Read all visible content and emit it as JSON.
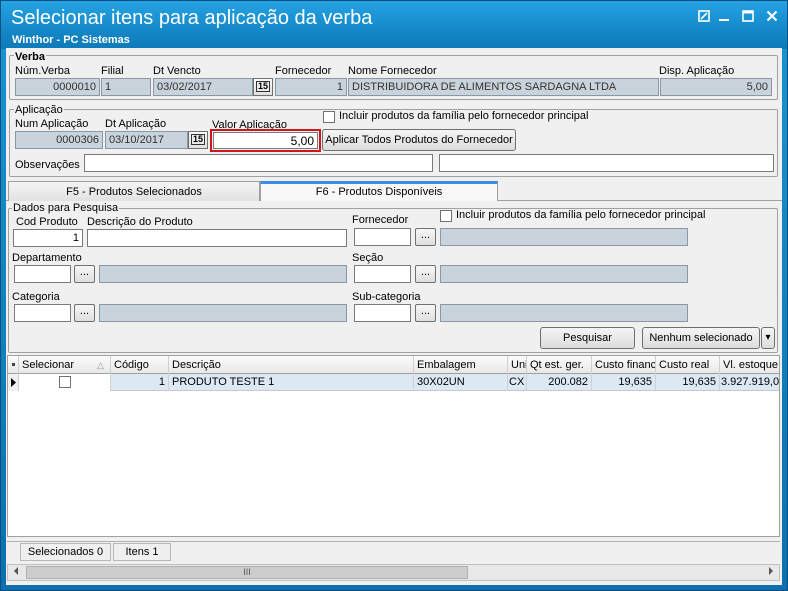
{
  "window": {
    "title": "Selecionar itens para aplicação da verba",
    "subtitle": "Winthor - PC Sistemas"
  },
  "verba": {
    "group_label": "Verba",
    "num_verba_label": "Núm.Verba",
    "num_verba": "0000010",
    "filial_label": "Filial",
    "filial": "1",
    "dt_vencto_label": "Dt Vencto",
    "dt_vencto": "03/02/2017",
    "fornecedor_label": "Fornecedor",
    "fornecedor": "1",
    "nome_fornecedor_label": "Nome Fornecedor",
    "nome_fornecedor": "DISTRIBUIDORA DE ALIMENTOS SARDAGNA LTDA",
    "disp_aplicacao_label": "Disp. Aplicação",
    "disp_aplicacao": "5,00"
  },
  "aplicacao": {
    "group_label": "Aplicação",
    "num_aplicacao_label": "Num Aplicação",
    "num_aplicacao": "0000306",
    "dt_aplicacao_label": "Dt Aplicação",
    "dt_aplicacao": "03/10/2017",
    "valor_aplicacao_label": "Valor Aplicação",
    "valor_aplicacao": "5,00",
    "incluir_familia_label": "Incluir produtos da família pelo fornecedor principal",
    "aplicar_todos_label": "Aplicar Todos Produtos do Fornecedor",
    "observacoes_label": "Observações"
  },
  "tabs": [
    {
      "label": "F5 - Produtos Selecionados",
      "active": false
    },
    {
      "label": "F6 - Produtos Disponíveis",
      "active": true
    }
  ],
  "pesquisa": {
    "group_label": "Dados para Pesquisa",
    "cod_produto_label": "Cod Produto",
    "cod_produto": "1",
    "descricao_label": "Descrição do Produto",
    "fornecedor_label": "Fornecedor",
    "incluir_familia_label": "Incluir produtos da família pelo fornecedor principal",
    "departamento_label": "Departamento",
    "secao_label": "Seção",
    "categoria_label": "Categoria",
    "subcategoria_label": "Sub-categoria",
    "pesquisar_label": "Pesquisar",
    "nenhum_label": "Nenhum selecionado",
    "lookup_glyph": "...",
    "dropdown_glyph": "▾"
  },
  "grid": {
    "columns": [
      "Selecionar",
      "Código",
      "Descrição",
      "Embalagem",
      "Uni",
      "Qt est. ger.",
      "Custo financ",
      "Custo real",
      "Vl. estoque"
    ],
    "rows": [
      {
        "codigo": "1",
        "descricao": "PRODUTO TESTE 1",
        "embalagem": "30X02UN",
        "uni": "CX",
        "qt_est": "200.082",
        "custo_fin": "19,635",
        "custo_real": "19,635",
        "vl_estoque": "3.927.919,0"
      }
    ]
  },
  "status": {
    "selecionados": "Selecionados 0",
    "itens": "Itens 1"
  },
  "scroll_grip": "III",
  "colors": {
    "title_bar": "#1488c8",
    "readonly_field": "#c8d3dc",
    "highlight_border": "#d0161b",
    "active_tab_accent": "#3a8ee6",
    "row_selected": "#dde8f5"
  }
}
